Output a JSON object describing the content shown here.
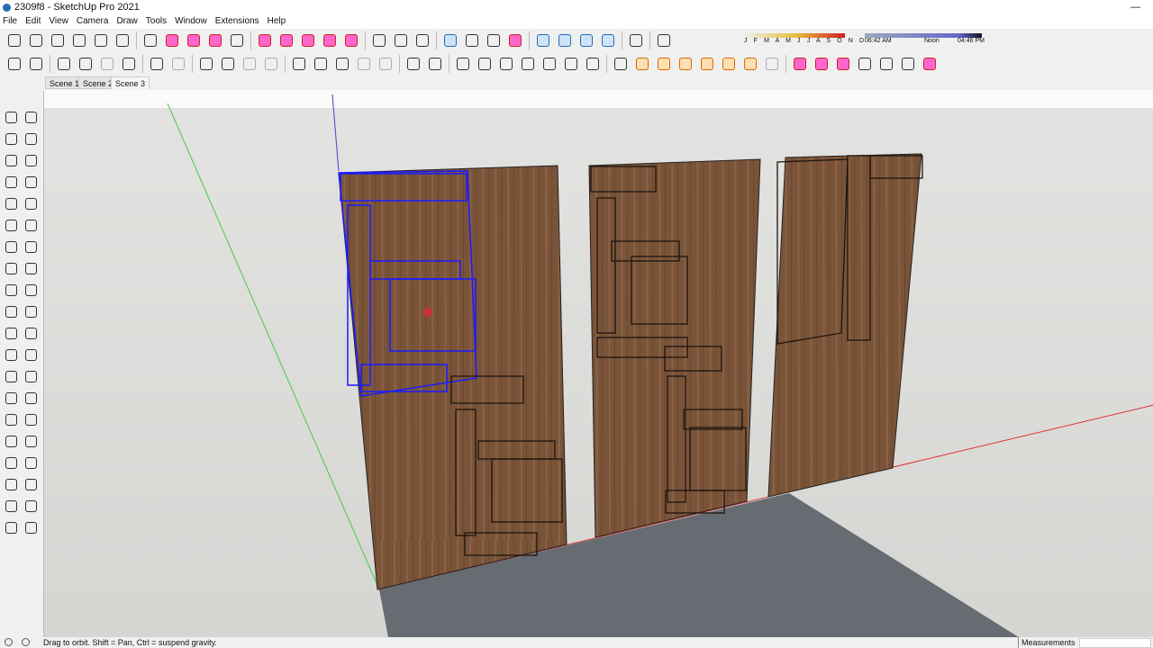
{
  "window": {
    "title": "2309f8 - SketchUp Pro 2021",
    "minimize": "—"
  },
  "menu": [
    "File",
    "Edit",
    "View",
    "Camera",
    "Draw",
    "Tools",
    "Window",
    "Extensions",
    "Help"
  ],
  "toolbar1": [
    [
      "iso-view-icon",
      ""
    ],
    [
      "top-view-icon",
      ""
    ],
    [
      "front-view-icon",
      ""
    ],
    [
      "right-view-icon",
      ""
    ],
    [
      "back-view-icon",
      ""
    ],
    [
      "left-view-icon",
      ""
    ],
    "|",
    [
      "select-icon",
      ""
    ],
    [
      "eraser-icon",
      "red"
    ],
    [
      "pencil-icon",
      "red"
    ],
    [
      "arc-icon",
      "red"
    ],
    [
      "rectangle-icon",
      ""
    ],
    "|",
    [
      "push-pull-icon",
      "red"
    ],
    [
      "move-icon",
      "red"
    ],
    [
      "rotate-icon",
      "red"
    ],
    [
      "scale-icon",
      "red"
    ],
    [
      "offset-icon",
      "red"
    ],
    "|",
    [
      "tape-measure-icon",
      ""
    ],
    [
      "text-icon",
      ""
    ],
    [
      "paint-bucket-icon",
      ""
    ],
    "|",
    [
      "orbit-icon",
      "blue"
    ],
    [
      "pan-icon",
      ""
    ],
    [
      "zoom-icon",
      ""
    ],
    [
      "zoom-extents-icon",
      "red"
    ],
    "|",
    [
      "warehouse-icon",
      "blue"
    ],
    [
      "extension-warehouse-icon",
      "blue"
    ],
    [
      "sandbox-icon",
      "blue"
    ],
    [
      "layout-icon",
      "blue"
    ],
    "|",
    [
      "dimension-icon",
      ""
    ],
    "|",
    [
      "shadows-toggle-icon",
      ""
    ]
  ],
  "toolbar2": [
    [
      "style-x-ray-icon",
      ""
    ],
    [
      "style-back-edges-icon",
      ""
    ],
    "|",
    [
      "wireframe-icon",
      ""
    ],
    [
      "hidden-line-icon",
      ""
    ],
    [
      "shaded-icon",
      "gray"
    ],
    [
      "shaded-textures-icon",
      ""
    ],
    "|",
    [
      "section-plane-icon",
      ""
    ],
    [
      "section-fill-icon",
      "gray"
    ],
    "|",
    [
      "display-section-icon",
      ""
    ],
    [
      "display-cuts-icon",
      ""
    ],
    [
      "section-cut-icon",
      "gray"
    ],
    [
      "lock-icon",
      "gray"
    ],
    "|",
    [
      "solid-union-icon",
      ""
    ],
    [
      "solid-intersect-icon",
      ""
    ],
    [
      "solid-subtract-icon",
      ""
    ],
    [
      "solid-trim-icon",
      "gray"
    ],
    [
      "solid-split-icon",
      "gray"
    ],
    "|",
    [
      "outer-shell-icon",
      ""
    ],
    [
      "component-icon",
      ""
    ],
    "|",
    [
      "sandbox-from-contours-icon",
      ""
    ],
    [
      "sandbox-scratch-icon",
      ""
    ],
    [
      "smoove-icon",
      ""
    ],
    [
      "stamp-icon",
      ""
    ],
    [
      "drape-icon",
      ""
    ],
    [
      "add-detail-icon",
      ""
    ],
    [
      "flip-edge-icon",
      ""
    ],
    "|",
    [
      "dynamic-component-icon",
      ""
    ],
    [
      "follow-me-icon",
      "orange"
    ],
    [
      "orange-tool-icon",
      "orange"
    ],
    [
      "orange-tool-2-icon",
      "orange"
    ],
    [
      "orange-tool-3-icon",
      "orange"
    ],
    [
      "orange-tool-4-icon",
      "orange"
    ],
    [
      "orange-tool-5-icon",
      "orange"
    ],
    [
      "orange-tool-6-icon",
      "gray"
    ],
    "|",
    [
      "extension-1-icon",
      "red"
    ],
    [
      "extension-2-icon",
      "red"
    ],
    [
      "extension-3-icon",
      "red"
    ],
    [
      "extension-4-icon",
      ""
    ],
    [
      "extension-5-icon",
      ""
    ],
    [
      "extension-6-icon",
      ""
    ],
    [
      "extension-7-icon",
      "red"
    ]
  ],
  "shadow": {
    "months": "J F M A M J J A S O N D",
    "time_start": "06:42 AM",
    "time_mid": "Noon",
    "time_end": "04:46 PM"
  },
  "scenes": [
    {
      "label": "Scene 1"
    },
    {
      "label": "Scene 2"
    },
    {
      "label": "Scene 3",
      "active": true
    }
  ],
  "lefttools": [
    "select-icon",
    "component-icon",
    "paint-bucket-icon",
    "eraser-icon",
    "line-icon",
    "freehand-icon",
    "rectangle-icon",
    "rotated-rectangle-icon",
    "circle-icon",
    "polygon-icon",
    "arc-icon",
    "two-point-arc-icon",
    "three-point-arc-icon",
    "pie-icon",
    "move-icon",
    "push-pull-icon",
    "rotate-icon",
    "follow-me-icon",
    "scale-icon",
    "offset-icon",
    "tape-measure-icon",
    "dimension-icon",
    "protractor-icon",
    "text-icon",
    "axes-icon",
    "3d-text-icon",
    "orbit-icon",
    "pan-icon",
    "zoom-icon",
    "zoom-window-icon",
    "zoom-extents-icon",
    "previous-view-icon",
    "position-camera-icon",
    "look-around-icon",
    "walk-icon",
    "section-plane-icon",
    "warehouse-icon",
    "extension-icon",
    "sandbox-icon",
    "layout-icon"
  ],
  "status": {
    "hint": "Drag to orbit. Shift = Pan, Ctrl = suspend gravity.",
    "measurements_label": "Measurements",
    "measurements_value": ""
  },
  "colors": {
    "wood": "#7a5438",
    "selection": "#1a1aff",
    "ground": "#c9c9c6",
    "floor": "#666c72"
  }
}
